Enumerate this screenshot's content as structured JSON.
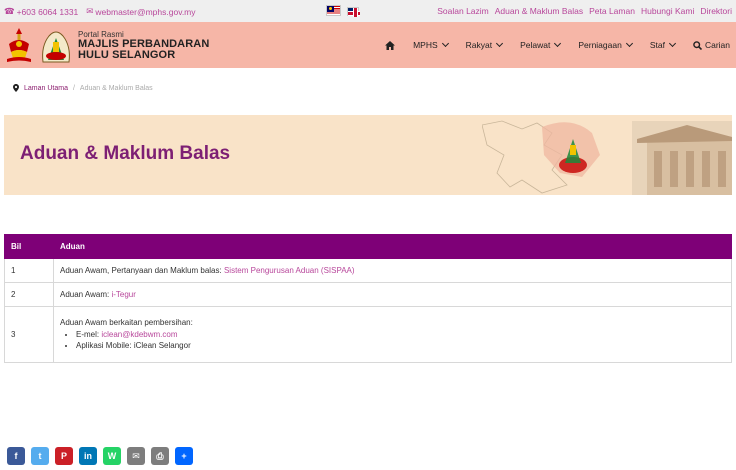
{
  "topbar": {
    "phone": "+603 6064 1331",
    "email": "webmaster@mphs.gov.my",
    "links": [
      "Soalan Lazim",
      "Aduan & Maklum Balas",
      "Peta Laman",
      "Hubungi Kami",
      "Direktori"
    ]
  },
  "header": {
    "portal_label": "Portal Rasmi",
    "org_line1": "MAJLIS PERBANDARAN",
    "org_line2": "HULU SELANGOR",
    "nav": {
      "mphs": "MPHS",
      "rakyat": "Rakyat",
      "pelawat": "Pelawat",
      "perniagaan": "Perniagaan",
      "staf": "Staf",
      "search": "Carian"
    }
  },
  "breadcrumb": {
    "home": "Laman Utama",
    "separator": "/",
    "current": "Aduan & Maklum Balas"
  },
  "banner": {
    "title": "Aduan & Maklum Balas"
  },
  "table": {
    "headers": [
      "Bil",
      "Aduan"
    ],
    "rows": [
      {
        "no": "1",
        "text": "Aduan Awam, Pertanyaan dan Maklum balas: ",
        "link": "Sistem Pengurusan Aduan (SISPAA)"
      },
      {
        "no": "2",
        "text": "Aduan Awam: ",
        "link": "i-Tegur"
      },
      {
        "no": "3",
        "text": "Aduan Awam berkaitan pembersihan:",
        "email_label": "E-mel: ",
        "email": "iclean@kdebwm.com",
        "app_label": "Aplikasi Mobile: ",
        "app": "iClean Selangor"
      }
    ]
  },
  "colors": {
    "accent": "#7e0077",
    "link": "#b8479b",
    "header_bg": "#f6b6a7",
    "banner_bg": "#f9e3c8"
  },
  "share": [
    {
      "name": "facebook-icon",
      "glyph": "f",
      "color": "#3b5998"
    },
    {
      "name": "twitter-icon",
      "glyph": "t",
      "color": "#55acee"
    },
    {
      "name": "pinterest-icon",
      "glyph": "P",
      "color": "#cb2027"
    },
    {
      "name": "linkedin-icon",
      "glyph": "in",
      "color": "#0077b5"
    },
    {
      "name": "whatsapp-icon",
      "glyph": "W",
      "color": "#25d366"
    },
    {
      "name": "email-icon",
      "glyph": "✉",
      "color": "#7d7d7d"
    },
    {
      "name": "print-icon",
      "glyph": "⎙",
      "color": "#7d7d7d"
    },
    {
      "name": "share-icon",
      "glyph": "+",
      "color": "#0166ff"
    }
  ]
}
